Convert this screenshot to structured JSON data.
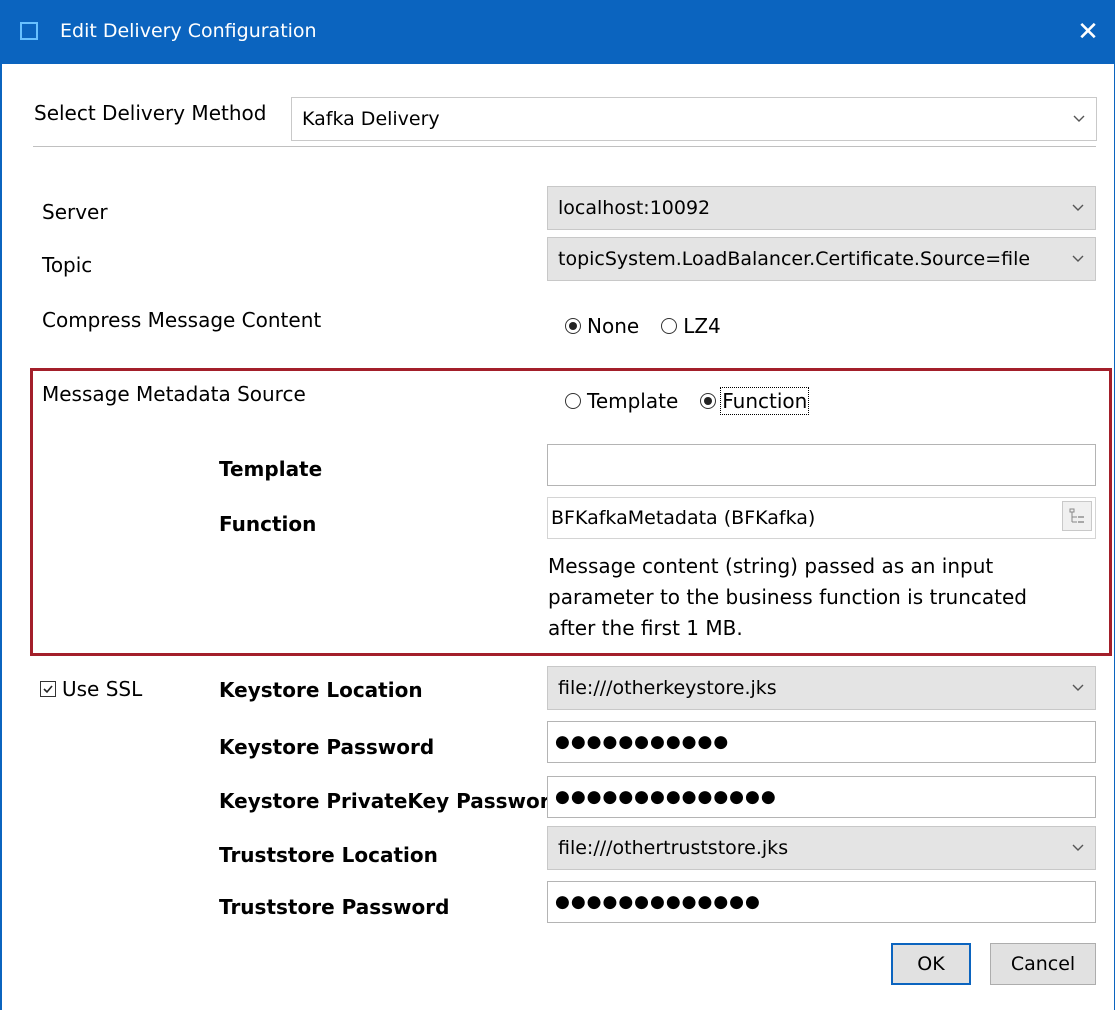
{
  "window": {
    "title": "Edit Delivery Configuration",
    "close_glyph": "✕"
  },
  "delivery_method": {
    "label": "Select Delivery Method",
    "value": "Kafka Delivery"
  },
  "server": {
    "label": "Server",
    "value": "localhost:10092"
  },
  "topic": {
    "label": "Topic",
    "value": "topicSystem.LoadBalancer.Certificate.Source=file"
  },
  "compress": {
    "label": "Compress Message Content",
    "options": [
      {
        "label": "None",
        "selected": true
      },
      {
        "label": "LZ4",
        "selected": false
      }
    ]
  },
  "metadata": {
    "label": "Message Metadata Source",
    "options": [
      {
        "label": "Template",
        "selected": false
      },
      {
        "label": "Function",
        "selected": true
      }
    ],
    "template_label": "Template",
    "template_value": "",
    "function_label": "Function",
    "function_value": "BFKafkaMetadata (BFKafka)",
    "description": "Message content (string) passed as an input parameter to the business function is truncated after the first 1 MB.",
    "highlight_color": "#a31f2a"
  },
  "ssl": {
    "label": "Use SSL",
    "checked": true,
    "keystore_location_label": "Keystore Location",
    "keystore_location_value": "file:///otherkeystore.jks",
    "keystore_password_label": "Keystore Password",
    "keystore_password_value": "●●●●●●●●●●●",
    "keystore_privatekey_label": "Keystore PrivateKey Password",
    "keystore_privatekey_value": "●●●●●●●●●●●●●●",
    "truststore_location_label": "Truststore Location",
    "truststore_location_value": "file:///othertruststore.jks",
    "truststore_password_label": "Truststore Password",
    "truststore_password_value": "●●●●●●●●●●●●●"
  },
  "buttons": {
    "ok": "OK",
    "cancel": "Cancel"
  },
  "colors": {
    "titlebar": "#0b64bf",
    "accent": "#0b64bf"
  }
}
